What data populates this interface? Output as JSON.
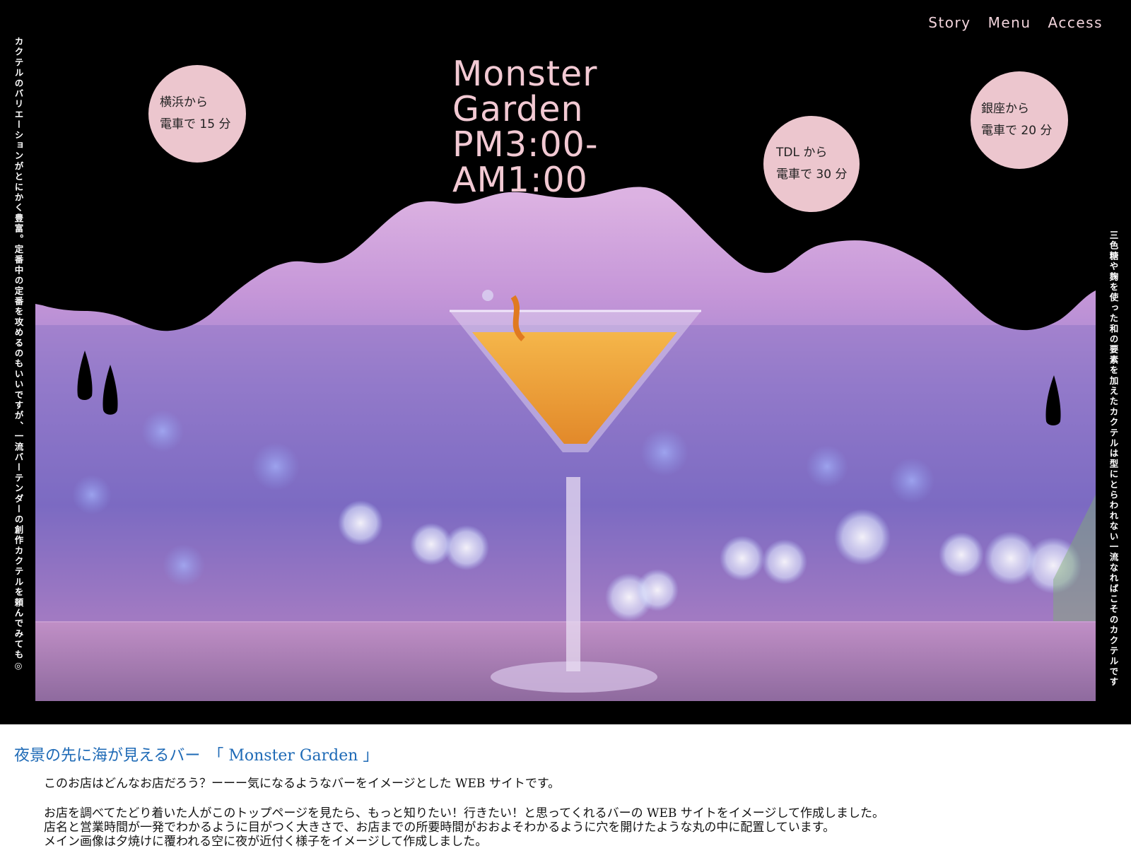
{
  "nav": {
    "items": [
      "Story",
      "Menu",
      "Access"
    ]
  },
  "side_text": {
    "left": "カクテルのバリエーションがとにかく豊富。定番中の定番を攻めるのもいいですが、一流バーテンダーの創作カクテルを頼んでみても◎",
    "right": "三色糖や麹を使った和の要素を加えたカクテルは型にとらわれない一流なればこそのカクテルです"
  },
  "title": {
    "line1": "Monster",
    "line2": "Garden",
    "line3": "PM3:00-",
    "line4": "AM1:00"
  },
  "access": [
    {
      "from": "横浜から",
      "time": "電車で 15 分"
    },
    {
      "from": "TDL から",
      "time": "電車で 30 分"
    },
    {
      "from": "銀座から",
      "time": "電車で 20 分"
    }
  ],
  "intro": {
    "heading": "夜景の先に海が見えるバー　「 Monster Garden 」",
    "p1": "このお店はどんなお店だろう？ーーー気になるようなバーをイメージとした WEB サイトです。",
    "p2": "お店を調べてたどり着いた人がこのトップページを見たら、もっと知りたい！行きたい！と思ってくれるバーの WEB サイトをイメージして作成しました。",
    "p3": "店名と営業時間が一発でわかるように目がつく大きさで、お店までの所要時間がおおよそわかるように穴を開けたような丸の中に配置しています。",
    "p4": "メイン画像は夕焼けに覆われる空に夜が近付く様子をイメージして作成しました。"
  },
  "colors": {
    "title": "#f2c9d3",
    "circle": "#ecc6ce",
    "heading": "#1e6ab6",
    "background": "#000000"
  }
}
